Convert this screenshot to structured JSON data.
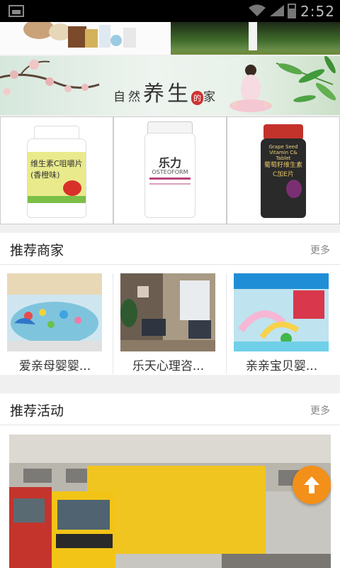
{
  "status_bar": {
    "time": "2:52"
  },
  "banner": {
    "title_part1": "自然",
    "title_big": "养生",
    "title_badge": "的",
    "title_part2": "家"
  },
  "products": [
    {
      "name_cn": "维生素C咀嚼片",
      "flavor": "(香橙味)",
      "cap_color": "#ffffff",
      "label_color": "#e9ea8c"
    },
    {
      "name_cn": "乐力",
      "name_en": "OSTEOFORM",
      "cap_color": "#f4f4f4",
      "label_color": "#ffffff"
    },
    {
      "name_en": "Grape Seed Vitamin C& Tablet",
      "name_cn": "葡萄籽维生素C加E片",
      "cap_color": "#c4322c",
      "label_color": "#2a2a2a"
    }
  ],
  "recommended_merchants": {
    "title": "推荐商家",
    "more": "更多",
    "items": [
      {
        "name": "爱亲母婴婴..."
      },
      {
        "name": "乐天心理咨..."
      },
      {
        "name": "亲亲宝贝婴..."
      }
    ]
  },
  "recommended_activities": {
    "title": "推荐活动",
    "more": "更多"
  },
  "fab": {
    "icon": "arrow-up-icon",
    "color": "#f39019"
  }
}
